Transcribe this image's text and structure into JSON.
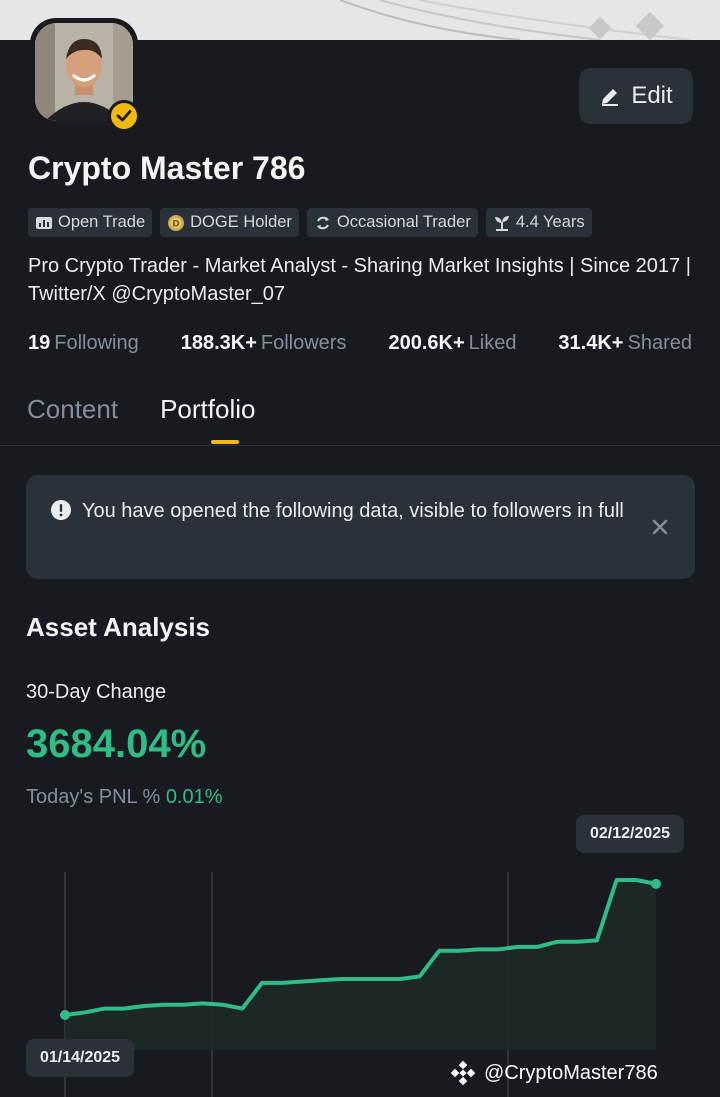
{
  "profile": {
    "name": "Crypto Master 786",
    "edit_label": "Edit",
    "tags": [
      {
        "label": "Open Trade",
        "icon": "open-trade-icon"
      },
      {
        "label": "DOGE Holder",
        "icon": "doge-coin-icon"
      },
      {
        "label": "Occasional Trader",
        "icon": "trader-cycle-icon"
      },
      {
        "label": "4.4 Years",
        "icon": "sprout-icon"
      }
    ],
    "bio": "Pro Crypto Trader - Market Analyst - Sharing Market Insights | Since 2017 | Twitter/X @CryptoMaster_07",
    "stats": [
      {
        "value": "19",
        "label": "Following"
      },
      {
        "value": "188.3K+",
        "label": "Followers"
      },
      {
        "value": "200.6K+",
        "label": "Liked"
      },
      {
        "value": "31.4K+",
        "label": "Shared"
      }
    ]
  },
  "tabs": [
    {
      "label": "Content",
      "active": false
    },
    {
      "label": "Portfolio",
      "active": true
    }
  ],
  "notice": {
    "text": "You have opened the following data, visible to followers in full"
  },
  "asset_analysis": {
    "title": "Asset Analysis",
    "change_label": "30-Day Change",
    "change_value": "3684.04%",
    "pnl_label": "Today's PNL %",
    "pnl_value": "0.01%"
  },
  "chart_data": {
    "type": "area",
    "start_date": "01/14/2025",
    "end_date": "02/12/2025",
    "values": [
      0,
      0.2,
      0.5,
      0.5,
      0.7,
      0.8,
      0.8,
      0.9,
      0.8,
      0.5,
      2.5,
      2.5,
      2.6,
      2.7,
      2.8,
      2.8,
      2.8,
      2.8,
      3.0,
      5.0,
      5.0,
      5.1,
      5.1,
      5.3,
      5.3,
      5.7,
      5.7,
      5.8,
      10.5,
      10.5,
      10.2
    ],
    "colors": {
      "line": "#2ebd85",
      "fill": "#1c2a27",
      "grid": "#4a4f57"
    }
  },
  "watermark": {
    "text": "@CryptoMaster786"
  }
}
